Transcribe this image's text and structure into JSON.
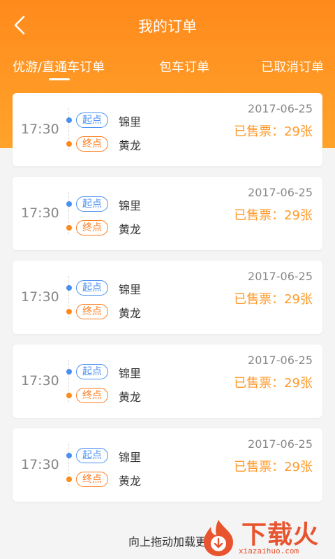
{
  "header": {
    "title": "我的订单"
  },
  "tabs": [
    {
      "label": "优游/直通车订单",
      "active": true
    },
    {
      "label": "包车订单",
      "active": false
    },
    {
      "label": "已取消订单",
      "active": false
    }
  ],
  "orders": [
    {
      "time": "17:30",
      "start_tag": "起点",
      "start": "锦里",
      "end_tag": "终点",
      "end": "黄龙",
      "date": "2017-06-25",
      "sold": "已售票：29张"
    },
    {
      "time": "17:30",
      "start_tag": "起点",
      "start": "锦里",
      "end_tag": "终点",
      "end": "黄龙",
      "date": "2017-06-25",
      "sold": "已售票：29张"
    },
    {
      "time": "17:30",
      "start_tag": "起点",
      "start": "锦里",
      "end_tag": "终点",
      "end": "黄龙",
      "date": "2017-06-25",
      "sold": "已售票：29张"
    },
    {
      "time": "17:30",
      "start_tag": "起点",
      "start": "锦里",
      "end_tag": "终点",
      "end": "黄龙",
      "date": "2017-06-25",
      "sold": "已售票：29张"
    },
    {
      "time": "17:30",
      "start_tag": "起点",
      "start": "锦里",
      "end_tag": "终点",
      "end": "黄龙",
      "date": "2017-06-25",
      "sold": "已售票：29张"
    }
  ],
  "footer": {
    "load_more": "向上拖动加载更"
  },
  "watermark": {
    "text": "下载火",
    "sub": "xiazaihuo.com"
  },
  "colors": {
    "primary": "#ff8a1c",
    "start": "#4a90f2",
    "end": "#ff7a1c",
    "sold": "#ff9a2a"
  }
}
